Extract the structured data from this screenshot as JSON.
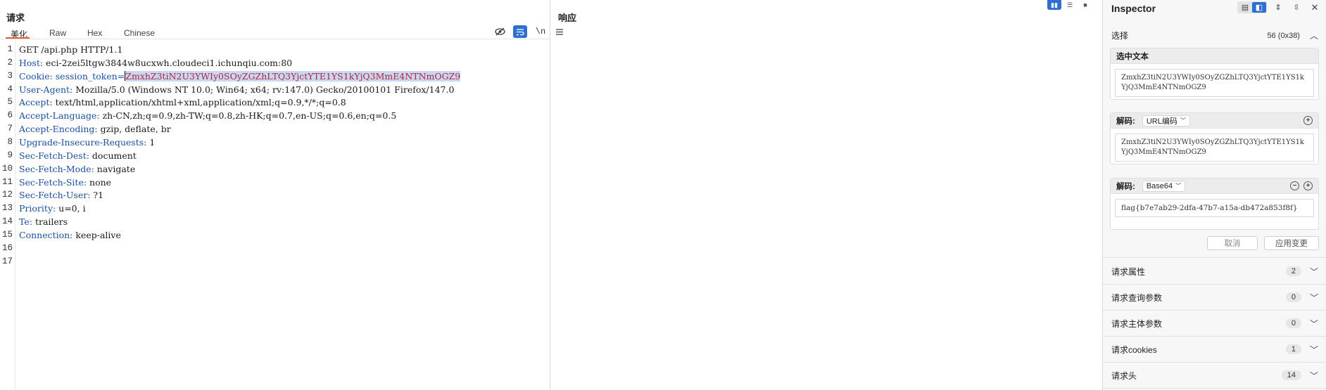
{
  "request": {
    "title": "请求",
    "tabs": [
      "美化",
      "Raw",
      "Hex",
      "Chinese"
    ],
    "toolbar_newline": "\\n",
    "lines": [
      {
        "n": "1",
        "text": "GET /api.php HTTP/1.1"
      },
      {
        "n": "2",
        "key": "Host:",
        "val": " eci-2zei5ltgw3844w8ucxwh.cloudeci1.ichunqiu.com:80"
      },
      {
        "n": "3",
        "key": "Cookie:",
        "cookie_name": " session_token=",
        "cookie_value": "ZmxhZ3tiN2U3YWIy0SOyZGZhLTQ3YjctYTE1YS1kYjQ3MmE4NTNmOGZ9"
      },
      {
        "n": "4",
        "key": "User-Agent:",
        "val": " Mozilla/5.0 (Windows NT 10.0; Win64; x64; rv:147.0) Gecko/20100101 Firefox/147.0"
      },
      {
        "n": "5",
        "key": "Accept:",
        "val": " text/html,application/xhtml+xml,application/xml;q=0.9,*/*;q=0.8"
      },
      {
        "n": "6",
        "key": "Accept-Language:",
        "val": " zh-CN,zh;q=0.9,zh-TW;q=0.8,zh-HK;q=0.7,en-US;q=0.6,en;q=0.5"
      },
      {
        "n": "7",
        "key": "Accept-Encoding:",
        "val": " gzip, deflate, br"
      },
      {
        "n": "8",
        "key": "Upgrade-Insecure-Requests:",
        "val": " 1"
      },
      {
        "n": "9",
        "key": "Sec-Fetch-Dest:",
        "val": " document"
      },
      {
        "n": "10",
        "key": "Sec-Fetch-Mode:",
        "val": " navigate"
      },
      {
        "n": "11",
        "key": "Sec-Fetch-Site:",
        "val": " none"
      },
      {
        "n": "12",
        "key": "Sec-Fetch-User:",
        "val": " ?1"
      },
      {
        "n": "13",
        "key": "Priority:",
        "val": " u=0, i"
      },
      {
        "n": "14",
        "key": "Te:",
        "val": " trailers"
      },
      {
        "n": "15",
        "key": "Connection:",
        "val": " keep-alive"
      },
      {
        "n": "16",
        "text": ""
      },
      {
        "n": "17",
        "text": ""
      }
    ]
  },
  "response": {
    "title": "响应"
  },
  "inspector": {
    "title": "Inspector",
    "selection": {
      "label": "选择",
      "count": "56 (0x38)"
    },
    "selected_text": {
      "title": "选中文本",
      "value": "ZmxhZ3tiN2U3YWIy0SOyZGZhLTQ3YjctYTE1YS1kYjQ3MmE4NTNmOGZ9"
    },
    "decode1": {
      "label": "解码:",
      "type": "URL编码",
      "value": "ZmxhZ3tiN2U3YWIy0SOyZGZhLTQ3YjctYTE1YS1kYjQ3MmE4NTNmOGZ9"
    },
    "decode2": {
      "label": "解码:",
      "type": "Base64",
      "value": "flag{b7e7ab29-2dfa-47b7-a15a-db472a853f8f}"
    },
    "cancel": "取消",
    "apply": "应用变更",
    "sections": [
      {
        "label": "请求属性",
        "count": "2"
      },
      {
        "label": "请求查询参数",
        "count": "0"
      },
      {
        "label": "请求主体参数",
        "count": "0"
      },
      {
        "label": "请求cookies",
        "count": "1"
      },
      {
        "label": "请求头",
        "count": "14"
      }
    ]
  }
}
